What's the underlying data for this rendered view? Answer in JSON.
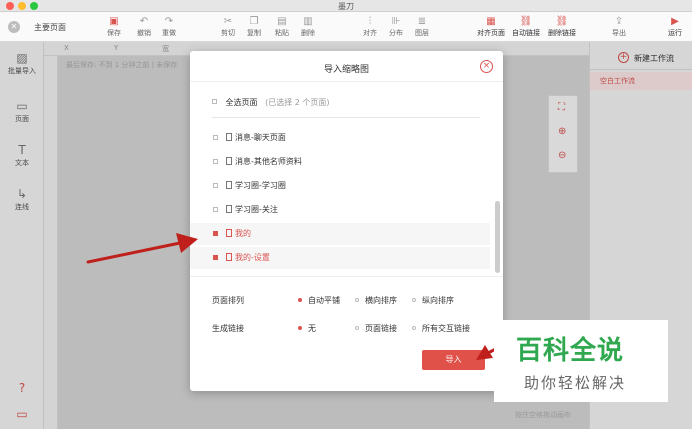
{
  "window": {
    "title": "墨刀"
  },
  "toolbar": {
    "page_title": "主要页面",
    "buttons": [
      {
        "label": "保存",
        "icon": "save-icon",
        "glyph": "▣",
        "red": true
      },
      {
        "label": "撤销",
        "icon": "undo-icon",
        "glyph": "↶"
      },
      {
        "label": "重做",
        "icon": "redo-icon",
        "glyph": "↷"
      },
      {
        "label": "剪切",
        "icon": "cut-icon",
        "glyph": "✂"
      },
      {
        "label": "复制",
        "icon": "copy-icon",
        "glyph": "❐"
      },
      {
        "label": "粘贴",
        "icon": "paste-icon",
        "glyph": "▤"
      },
      {
        "label": "删除",
        "icon": "delete-icon",
        "glyph": "▥"
      },
      {
        "label": "对齐",
        "icon": "align-icon",
        "glyph": "⫶"
      },
      {
        "label": "分布",
        "icon": "distribute-icon",
        "glyph": "⊪"
      },
      {
        "label": "图层",
        "icon": "layers-icon",
        "glyph": "≣"
      },
      {
        "label": "对齐页面",
        "icon": "align-page-icon",
        "glyph": "▦",
        "red": true,
        "dark": true
      },
      {
        "label": "自动链接",
        "icon": "auto-link-icon",
        "glyph": "⛓",
        "red": true,
        "dark": true
      },
      {
        "label": "删除链接",
        "icon": "delete-link-icon",
        "glyph": "⛓",
        "red": true,
        "dark": true
      },
      {
        "label": "导出",
        "icon": "export-icon",
        "glyph": "⇪"
      },
      {
        "label": "运行",
        "icon": "run-icon",
        "glyph": "▶",
        "red": true,
        "dark": true
      }
    ]
  },
  "ruler": {
    "labels": [
      "X",
      "Y",
      "宽"
    ]
  },
  "leftbar": {
    "items": [
      {
        "label": "批量导入",
        "icon": "image-import-icon",
        "glyph": "▨"
      },
      {
        "label": "页面",
        "icon": "page-icon",
        "glyph": "▭"
      },
      {
        "label": "文本",
        "icon": "text-icon",
        "glyph": "T"
      },
      {
        "label": "连线",
        "icon": "connector-icon",
        "glyph": "↳"
      }
    ]
  },
  "canvas": {
    "autosave_text": "最后保存: 不到 1 分钟之前 | 未保存"
  },
  "rightpanel": {
    "new_flow_label": "新建工作流",
    "flow_item_label": "空白工作流"
  },
  "hint": "按住空格拖动画布",
  "modal": {
    "title": "导入缩略图",
    "select_all_label": "全选页面",
    "selected_count": "(已选择 2 个页面)",
    "pages": [
      {
        "label": "消息-聊天页面",
        "selected": false
      },
      {
        "label": "消息-其他名师资料",
        "selected": false
      },
      {
        "label": "学习圈-学习圈",
        "selected": false
      },
      {
        "label": "学习圈-关注",
        "selected": false
      },
      {
        "label": "我的",
        "selected": true
      },
      {
        "label": "我的-设置",
        "selected": true
      }
    ],
    "layout_label": "页面排列",
    "layout_options": [
      {
        "label": "自动平铺",
        "selected": true
      },
      {
        "label": "横向排序",
        "selected": false
      },
      {
        "label": "纵向排序",
        "selected": false
      }
    ],
    "link_label": "生成链接",
    "link_options": [
      {
        "label": "无",
        "selected": true
      },
      {
        "label": "页面链接",
        "selected": false
      },
      {
        "label": "所有交互链接",
        "selected": false
      }
    ],
    "import_label": "导入"
  },
  "watermark": {
    "line1": "百科全说",
    "line2": "助你轻松解决"
  },
  "colors": {
    "accent": "#d9534f",
    "arrow": "#c0201c",
    "watermark": "#2fa84f"
  }
}
